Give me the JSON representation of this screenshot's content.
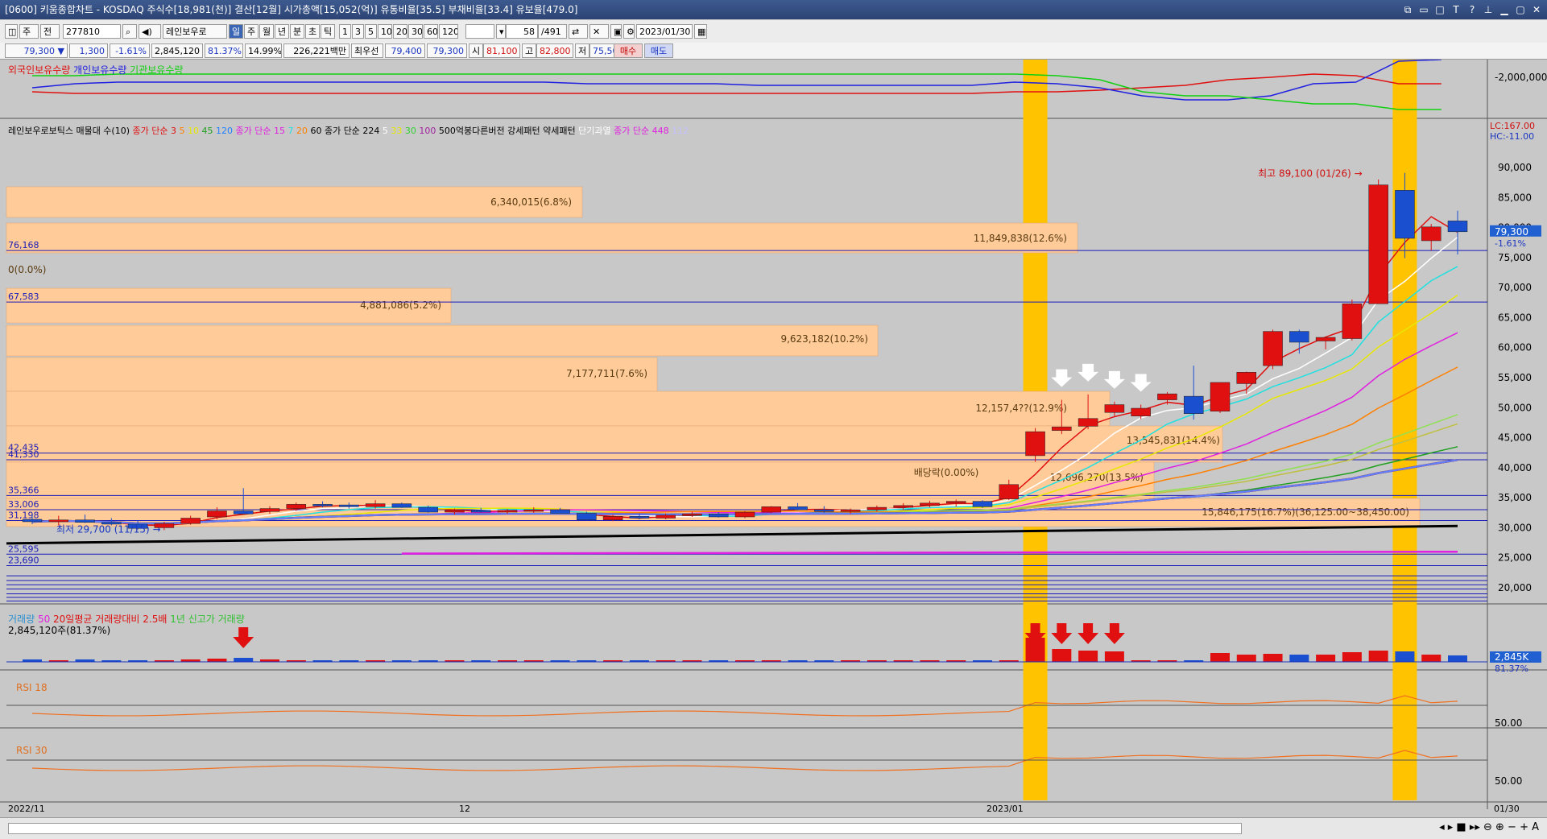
{
  "window": {
    "title": "[0600] 키움종합차트 - KOSDAQ 주식수[18,981(천)] 결산[12월] 시가총액[15,052(억)] 유통비율[35.5] 부채비율[33.4] 유보율[479.0]",
    "icon": "chart-window-icon"
  },
  "toolbar": {
    "mode1": "주",
    "mode2": "전",
    "code": "277810",
    "stock_name": "레인보우로",
    "period_tabs": [
      "일",
      "주",
      "월",
      "년",
      "분",
      "초",
      "틱"
    ],
    "selected_period": "일",
    "intervals": [
      "1",
      "3",
      "5",
      "10",
      "20",
      "30",
      "60",
      "120"
    ],
    "count": "58",
    "total": "/491",
    "date": "2023/01/30"
  },
  "quote": {
    "price": "79,300",
    "change": "1,300",
    "change_pct": "-1.61%",
    "volume": "2,845,120",
    "vol_pct": "81.37%",
    "turnover": "14.99%",
    "amount": "226,221백만",
    "best_sell_label": "최우선",
    "best_sell": "79,400",
    "best_buy": "79,300",
    "open_label": "시",
    "open": "81,100",
    "high_label": "고",
    "high": "82,800",
    "low_label": "저",
    "low": "75,500",
    "buy_btn": "매수",
    "sell_btn": "매도"
  },
  "holders_legend": [
    {
      "text": "외국인보유수량",
      "color": "#e01010"
    },
    {
      "text": "개인보유수량",
      "color": "#2020e0"
    },
    {
      "text": "기관보유수량",
      "color": "#10d010"
    }
  ],
  "price_legend": [
    {
      "text": "레인보우로보틱스 매물대 수(10)",
      "color": "#000"
    },
    {
      "text": "종가 단순 3",
      "color": "#e01010"
    },
    {
      "text": "5",
      "color": "#ff8000"
    },
    {
      "text": "10",
      "color": "#e8e800"
    },
    {
      "text": "45",
      "color": "#20a020"
    },
    {
      "text": "120",
      "color": "#2080ff"
    },
    {
      "text": "종가 단순 15",
      "color": "#e020e0"
    },
    {
      "text": "7",
      "color": "#20e0e0"
    },
    {
      "text": "20",
      "color": "#ff8000"
    },
    {
      "text": "60",
      "color": "#000"
    },
    {
      "text": "종가 단순 224",
      "color": "#000"
    },
    {
      "text": "5",
      "color": "#ffffff"
    },
    {
      "text": "33",
      "color": "#e8e800"
    },
    {
      "text": "30",
      "color": "#30d030"
    },
    {
      "text": "100",
      "color": "#a020a0"
    },
    {
      "text": "500억봉다른버전",
      "color": "#000"
    },
    {
      "text": "강세패턴",
      "color": "#000"
    },
    {
      "text": "약세패턴",
      "color": "#000"
    },
    {
      "text": "단기과열",
      "color": "#ffffff"
    },
    {
      "text": "종가 단순 448",
      "color": "#e020e0"
    },
    {
      "text": "112",
      "color": "#c0c0ff"
    }
  ],
  "volume_legend": [
    {
      "text": "거래량",
      "color": "#2a8fd0"
    },
    {
      "text": "50",
      "color": "#e020e0"
    },
    {
      "text": "20일평균 거래량대비 2.5배",
      "color": "#e01010"
    },
    {
      "text": "1년 신고가 거래량",
      "color": "#30c030"
    }
  ],
  "volume_info": "2,845,120주(81.37%)",
  "rsi_labels": [
    "RSI 18",
    "RSI 30"
  ],
  "chart_data": {
    "type": "candlestick",
    "y_axis_ticks": [
      "90,000",
      "85,000",
      "80,000",
      "75,000",
      "70,000",
      "65,000",
      "60,000",
      "55,000",
      "50,000",
      "45,000",
      "40,000",
      "35,000",
      "30,000",
      "25,000",
      "20,000"
    ],
    "holders_axis_tick": "-2,000,000",
    "lc_label": "LC:167.00",
    "hc_label": "HC:-11.00",
    "current_price_tag": "79,300",
    "current_change_tag": "-1.61%",
    "volume_tag": "2,845K",
    "volume_pct_tag": "81.37%",
    "rsi_tick": "50.00",
    "x_labels": [
      "2022/11",
      "12",
      "2023/01",
      "01/30"
    ],
    "candles": [
      {
        "o": 31400,
        "h": 32300,
        "l": 30600,
        "c": 31000
      },
      {
        "o": 31000,
        "h": 32000,
        "l": 30400,
        "c": 31300
      },
      {
        "o": 31300,
        "h": 32200,
        "l": 30800,
        "c": 30900
      },
      {
        "o": 30900,
        "h": 31600,
        "l": 30400,
        "c": 30600
      },
      {
        "o": 30600,
        "h": 31200,
        "l": 29700,
        "c": 29900
      },
      {
        "o": 30000,
        "h": 31000,
        "l": 29600,
        "c": 30700
      },
      {
        "o": 30700,
        "h": 32000,
        "l": 30500,
        "c": 31600
      },
      {
        "o": 31800,
        "h": 33400,
        "l": 31400,
        "c": 32800
      },
      {
        "o": 32800,
        "h": 36600,
        "l": 32400,
        "c": 32300
      },
      {
        "o": 32700,
        "h": 33600,
        "l": 32300,
        "c": 33200
      },
      {
        "o": 33200,
        "h": 34200,
        "l": 32800,
        "c": 33900
      },
      {
        "o": 33900,
        "h": 34400,
        "l": 33400,
        "c": 33700
      },
      {
        "o": 33800,
        "h": 34200,
        "l": 33200,
        "c": 33500
      },
      {
        "o": 33500,
        "h": 34600,
        "l": 33200,
        "c": 34000
      },
      {
        "o": 34000,
        "h": 34200,
        "l": 33300,
        "c": 33400
      },
      {
        "o": 33400,
        "h": 33700,
        "l": 32500,
        "c": 32600
      },
      {
        "o": 32600,
        "h": 33200,
        "l": 32200,
        "c": 32900
      },
      {
        "o": 32900,
        "h": 33300,
        "l": 32500,
        "c": 32600
      },
      {
        "o": 32600,
        "h": 33100,
        "l": 32300,
        "c": 32900
      },
      {
        "o": 32900,
        "h": 33400,
        "l": 32500,
        "c": 33000
      },
      {
        "o": 33000,
        "h": 33300,
        "l": 32400,
        "c": 32400
      },
      {
        "o": 32400,
        "h": 32700,
        "l": 31200,
        "c": 31300
      },
      {
        "o": 31300,
        "h": 32200,
        "l": 31100,
        "c": 31900
      },
      {
        "o": 31900,
        "h": 32300,
        "l": 31400,
        "c": 31600
      },
      {
        "o": 31600,
        "h": 32400,
        "l": 31400,
        "c": 32100
      },
      {
        "o": 32100,
        "h": 32700,
        "l": 31800,
        "c": 32300
      },
      {
        "o": 32300,
        "h": 32600,
        "l": 31700,
        "c": 31800
      },
      {
        "o": 31800,
        "h": 32800,
        "l": 31600,
        "c": 32600
      },
      {
        "o": 32600,
        "h": 33600,
        "l": 32400,
        "c": 33500
      },
      {
        "o": 33500,
        "h": 34100,
        "l": 32900,
        "c": 33000
      },
      {
        "o": 33000,
        "h": 33600,
        "l": 32500,
        "c": 32700
      },
      {
        "o": 32700,
        "h": 33200,
        "l": 32300,
        "c": 33000
      },
      {
        "o": 33000,
        "h": 33700,
        "l": 32700,
        "c": 33400
      },
      {
        "o": 33400,
        "h": 34100,
        "l": 33000,
        "c": 33700
      },
      {
        "o": 33700,
        "h": 34500,
        "l": 33400,
        "c": 34100
      },
      {
        "o": 34100,
        "h": 34700,
        "l": 33500,
        "c": 34400
      },
      {
        "o": 34400,
        "h": 34600,
        "l": 33300,
        "c": 33500
      },
      {
        "o": 34800,
        "h": 38000,
        "l": 34600,
        "c": 37200
      },
      {
        "o": 42000,
        "h": 46600,
        "l": 41000,
        "c": 46000
      },
      {
        "o": 46200,
        "h": 51300,
        "l": 45600,
        "c": 46800
      },
      {
        "o": 46900,
        "h": 52200,
        "l": 46400,
        "c": 48200
      },
      {
        "o": 49200,
        "h": 51000,
        "l": 48600,
        "c": 50500
      },
      {
        "o": 48600,
        "h": 50500,
        "l": 48100,
        "c": 49900
      },
      {
        "o": 51300,
        "h": 52600,
        "l": 50500,
        "c": 52300
      },
      {
        "o": 51900,
        "h": 57000,
        "l": 48000,
        "c": 49000
      },
      {
        "o": 49400,
        "h": 54200,
        "l": 49100,
        "c": 54200
      },
      {
        "o": 54000,
        "h": 56000,
        "l": 52300,
        "c": 55900
      },
      {
        "o": 57000,
        "h": 63000,
        "l": 56400,
        "c": 62700
      },
      {
        "o": 62700,
        "h": 63000,
        "l": 59000,
        "c": 60900
      },
      {
        "o": 61100,
        "h": 61700,
        "l": 59700,
        "c": 61700
      },
      {
        "o": 61500,
        "h": 68000,
        "l": 61200,
        "c": 67300
      },
      {
        "o": 67300,
        "h": 88000,
        "l": 67300,
        "c": 87100
      },
      {
        "o": 86200,
        "h": 89100,
        "l": 74900,
        "c": 78200
      },
      {
        "o": 77800,
        "h": 80600,
        "l": 76200,
        "c": 80100
      },
      {
        "o": 81100,
        "h": 82800,
        "l": 75500,
        "c": 79300
      }
    ],
    "volume_profile_labels": [
      "6,340,015(6.8%)",
      "11,849,838(12.6%)",
      "0(0.0%)",
      "4,881,086(5.2%)",
      "9,623,182(10.2%)",
      "7,177,711(7.6%)",
      "12,157,4??(12.9%)",
      "13,545,831(14.4%)",
      "12,696,270(13.5%)",
      "15,846,175(16.7%)(36,125.00~38,450.00)"
    ],
    "hline_labels": [
      "76,168",
      "67,583",
      "42,435",
      "41,330",
      "35,366",
      "33,006",
      "31,198",
      "25,595",
      "23,690"
    ],
    "annotations": {
      "high": "최고 89,100 (01/26)",
      "low": "최저 29,700 (11/15)",
      "dividend": "배당락(0.00%)"
    }
  }
}
